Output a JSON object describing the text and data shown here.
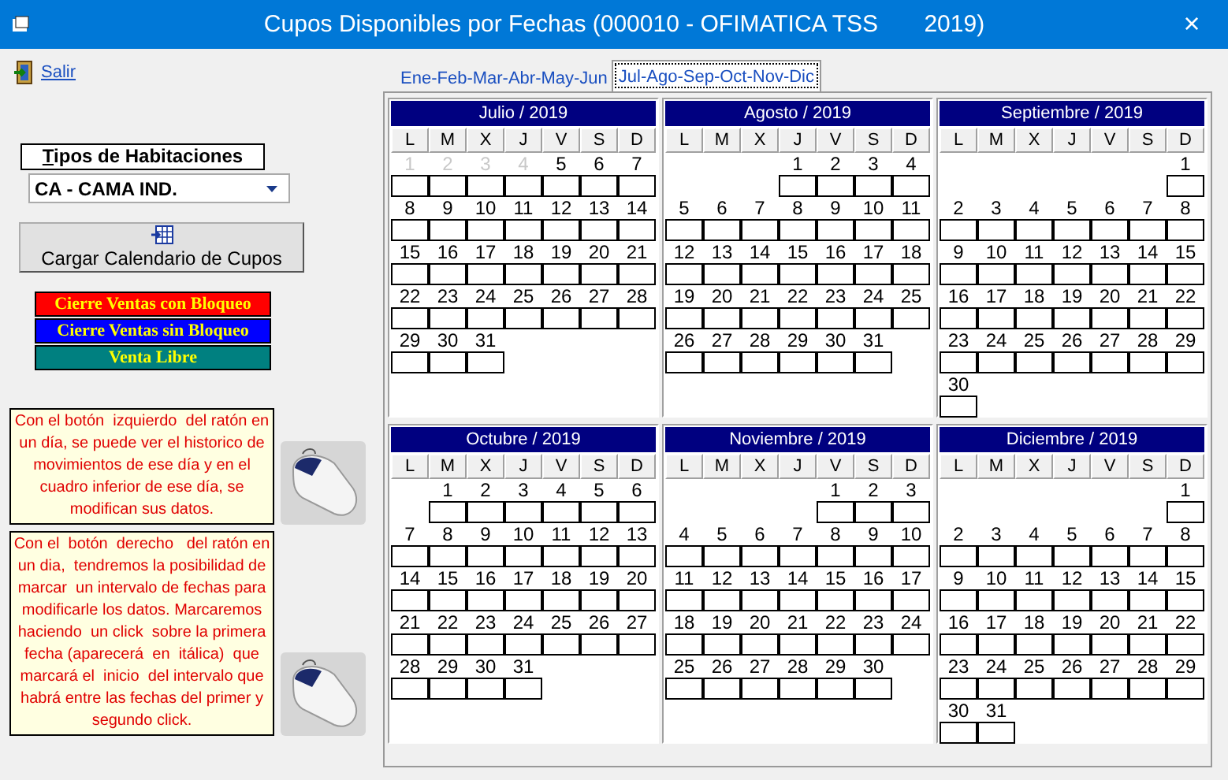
{
  "window": {
    "title": "Cupos Disponibles por Fechas (000010 - OFIMATICA TSS       2019)",
    "close": "×"
  },
  "exit_link": "Salir",
  "room_types": {
    "label": "Tipos de Habitaciones",
    "value": "CA - CAMA IND."
  },
  "load_button": "Cargar Calendario de Cupos",
  "legend": [
    {
      "label": "Cierre Ventas con Bloqueo",
      "color": "#ff0000"
    },
    {
      "label": "Cierre Ventas sin Bloqueo",
      "color": "#0000ff"
    },
    {
      "label": "Venta Libre",
      "color": "#008080"
    }
  ],
  "notes": [
    "Con el botón  izquierdo  del ratón en un día, se puede ver el historico de movimientos de ese día y en el cuadro inferior de ese día, se modifican sus datos.",
    "Con el  botón  derecho   del ratón en un dia,  tendremos la posibilidad de marcar  un intervalo de fechas para modificarle los datos. Marcaremos haciendo  un click  sobre la primera fecha (aparecerá  en  itálica)  que marcará el  inicio  del intervalo que habrá entre las fechas del primer y segundo click."
  ],
  "tabs": [
    {
      "label": "Ene-Feb-Mar-Abr-May-Jun",
      "selected": false
    },
    {
      "label": "Jul-Ago-Sep-Oct-Nov-Dic",
      "selected": true
    }
  ],
  "months": [
    {
      "title": "Julio / 2019",
      "weekdays": [
        "L",
        "M",
        "X",
        "J",
        "V",
        "S",
        "D"
      ],
      "weeks": [
        {
          "kind": "first",
          "days": [
            {
              "n": "1",
              "disabled": true
            },
            {
              "n": "2",
              "disabled": true
            },
            {
              "n": "3",
              "disabled": true
            },
            {
              "n": "4",
              "disabled": true
            },
            {
              "n": "5",
              "disabled": false
            },
            {
              "n": "6",
              "disabled": false
            },
            {
              "n": "7",
              "disabled": false
            }
          ]
        },
        {
          "kind": "full",
          "days": [
            {
              "n": "8",
              "disabled": false
            },
            {
              "n": "9",
              "disabled": false
            },
            {
              "n": "10",
              "disabled": false
            },
            {
              "n": "11",
              "disabled": false
            },
            {
              "n": "12",
              "disabled": false
            },
            {
              "n": "13",
              "disabled": false
            },
            {
              "n": "14",
              "disabled": false
            }
          ]
        },
        {
          "kind": "full",
          "days": [
            {
              "n": "15",
              "disabled": false
            },
            {
              "n": "16",
              "disabled": false
            },
            {
              "n": "17",
              "disabled": false
            },
            {
              "n": "18",
              "disabled": false
            },
            {
              "n": "19",
              "disabled": false
            },
            {
              "n": "20",
              "disabled": false
            },
            {
              "n": "21",
              "disabled": false
            }
          ]
        },
        {
          "kind": "full",
          "days": [
            {
              "n": "22",
              "disabled": false
            },
            {
              "n": "23",
              "disabled": false
            },
            {
              "n": "24",
              "disabled": false
            },
            {
              "n": "25",
              "disabled": false
            },
            {
              "n": "26",
              "disabled": false
            },
            {
              "n": "27",
              "disabled": false
            },
            {
              "n": "28",
              "disabled": false
            }
          ]
        },
        {
          "kind": "full",
          "days": [
            {
              "n": "29",
              "disabled": false
            },
            {
              "n": "30",
              "disabled": false
            },
            {
              "n": "31",
              "disabled": false
            }
          ]
        }
      ]
    },
    {
      "title": "Agosto / 2019",
      "weekdays": [
        "L",
        "M",
        "X",
        "J",
        "V",
        "S",
        "D"
      ],
      "weeks": [
        {
          "kind": "first",
          "days": [
            {
              "n": "1",
              "disabled": false
            },
            {
              "n": "2",
              "disabled": false
            },
            {
              "n": "3",
              "disabled": false
            },
            {
              "n": "4",
              "disabled": false
            }
          ]
        },
        {
          "kind": "full",
          "days": [
            {
              "n": "5",
              "disabled": false
            },
            {
              "n": "6",
              "disabled": false
            },
            {
              "n": "7",
              "disabled": false
            },
            {
              "n": "8",
              "disabled": false
            },
            {
              "n": "9",
              "disabled": false
            },
            {
              "n": "10",
              "disabled": false
            },
            {
              "n": "11",
              "disabled": false
            }
          ]
        },
        {
          "kind": "full",
          "days": [
            {
              "n": "12",
              "disabled": false
            },
            {
              "n": "13",
              "disabled": false
            },
            {
              "n": "14",
              "disabled": false
            },
            {
              "n": "15",
              "disabled": false
            },
            {
              "n": "16",
              "disabled": false
            },
            {
              "n": "17",
              "disabled": false
            },
            {
              "n": "18",
              "disabled": false
            }
          ]
        },
        {
          "kind": "full",
          "days": [
            {
              "n": "19",
              "disabled": false
            },
            {
              "n": "20",
              "disabled": false
            },
            {
              "n": "21",
              "disabled": false
            },
            {
              "n": "22",
              "disabled": false
            },
            {
              "n": "23",
              "disabled": false
            },
            {
              "n": "24",
              "disabled": false
            },
            {
              "n": "25",
              "disabled": false
            }
          ]
        },
        {
          "kind": "full",
          "days": [
            {
              "n": "26",
              "disabled": false
            },
            {
              "n": "27",
              "disabled": false
            },
            {
              "n": "28",
              "disabled": false
            },
            {
              "n": "29",
              "disabled": false
            },
            {
              "n": "30",
              "disabled": false
            },
            {
              "n": "31",
              "disabled": false
            }
          ]
        }
      ]
    },
    {
      "title": "Septiembre / 2019",
      "weekdays": [
        "L",
        "M",
        "X",
        "J",
        "V",
        "S",
        "D"
      ],
      "weeks": [
        {
          "kind": "first",
          "days": [
            {
              "n": "1",
              "disabled": false
            }
          ]
        },
        {
          "kind": "full",
          "days": [
            {
              "n": "2",
              "disabled": false
            },
            {
              "n": "3",
              "disabled": false
            },
            {
              "n": "4",
              "disabled": false
            },
            {
              "n": "5",
              "disabled": false
            },
            {
              "n": "6",
              "disabled": false
            },
            {
              "n": "7",
              "disabled": false
            },
            {
              "n": "8",
              "disabled": false
            }
          ]
        },
        {
          "kind": "full",
          "days": [
            {
              "n": "9",
              "disabled": false
            },
            {
              "n": "10",
              "disabled": false
            },
            {
              "n": "11",
              "disabled": false
            },
            {
              "n": "12",
              "disabled": false
            },
            {
              "n": "13",
              "disabled": false
            },
            {
              "n": "14",
              "disabled": false
            },
            {
              "n": "15",
              "disabled": false
            }
          ]
        },
        {
          "kind": "full",
          "days": [
            {
              "n": "16",
              "disabled": false
            },
            {
              "n": "17",
              "disabled": false
            },
            {
              "n": "18",
              "disabled": false
            },
            {
              "n": "19",
              "disabled": false
            },
            {
              "n": "20",
              "disabled": false
            },
            {
              "n": "21",
              "disabled": false
            },
            {
              "n": "22",
              "disabled": false
            }
          ]
        },
        {
          "kind": "full",
          "days": [
            {
              "n": "23",
              "disabled": false
            },
            {
              "n": "24",
              "disabled": false
            },
            {
              "n": "25",
              "disabled": false
            },
            {
              "n": "26",
              "disabled": false
            },
            {
              "n": "27",
              "disabled": false
            },
            {
              "n": "28",
              "disabled": false
            },
            {
              "n": "29",
              "disabled": false
            }
          ]
        },
        {
          "kind": "full",
          "days": [
            {
              "n": "30",
              "disabled": false
            }
          ]
        }
      ]
    },
    {
      "title": "Octubre / 2019",
      "weekdays": [
        "L",
        "M",
        "X",
        "J",
        "V",
        "S",
        "D"
      ],
      "weeks": [
        {
          "kind": "first",
          "days": [
            {
              "n": "1",
              "disabled": false
            },
            {
              "n": "2",
              "disabled": false
            },
            {
              "n": "3",
              "disabled": false
            },
            {
              "n": "4",
              "disabled": false
            },
            {
              "n": "5",
              "disabled": false
            },
            {
              "n": "6",
              "disabled": false
            }
          ]
        },
        {
          "kind": "full",
          "days": [
            {
              "n": "7",
              "disabled": false
            },
            {
              "n": "8",
              "disabled": false
            },
            {
              "n": "9",
              "disabled": false
            },
            {
              "n": "10",
              "disabled": false
            },
            {
              "n": "11",
              "disabled": false
            },
            {
              "n": "12",
              "disabled": false
            },
            {
              "n": "13",
              "disabled": false
            }
          ]
        },
        {
          "kind": "full",
          "days": [
            {
              "n": "14",
              "disabled": false
            },
            {
              "n": "15",
              "disabled": false
            },
            {
              "n": "16",
              "disabled": false
            },
            {
              "n": "17",
              "disabled": false
            },
            {
              "n": "18",
              "disabled": false
            },
            {
              "n": "19",
              "disabled": false
            },
            {
              "n": "20",
              "disabled": false
            }
          ]
        },
        {
          "kind": "full",
          "days": [
            {
              "n": "21",
              "disabled": false
            },
            {
              "n": "22",
              "disabled": false
            },
            {
              "n": "23",
              "disabled": false
            },
            {
              "n": "24",
              "disabled": false
            },
            {
              "n": "25",
              "disabled": false
            },
            {
              "n": "26",
              "disabled": false
            },
            {
              "n": "27",
              "disabled": false
            }
          ]
        },
        {
          "kind": "full",
          "days": [
            {
              "n": "28",
              "disabled": false
            },
            {
              "n": "29",
              "disabled": false
            },
            {
              "n": "30",
              "disabled": false
            },
            {
              "n": "31",
              "disabled": false
            }
          ]
        }
      ]
    },
    {
      "title": "Noviembre / 2019",
      "weekdays": [
        "L",
        "M",
        "X",
        "J",
        "V",
        "S",
        "D"
      ],
      "weeks": [
        {
          "kind": "first",
          "days": [
            {
              "n": "1",
              "disabled": false
            },
            {
              "n": "2",
              "disabled": false
            },
            {
              "n": "3",
              "disabled": false
            }
          ]
        },
        {
          "kind": "full",
          "days": [
            {
              "n": "4",
              "disabled": false
            },
            {
              "n": "5",
              "disabled": false
            },
            {
              "n": "6",
              "disabled": false
            },
            {
              "n": "7",
              "disabled": false
            },
            {
              "n": "8",
              "disabled": false
            },
            {
              "n": "9",
              "disabled": false
            },
            {
              "n": "10",
              "disabled": false
            }
          ]
        },
        {
          "kind": "full",
          "days": [
            {
              "n": "11",
              "disabled": false
            },
            {
              "n": "12",
              "disabled": false
            },
            {
              "n": "13",
              "disabled": false
            },
            {
              "n": "14",
              "disabled": false
            },
            {
              "n": "15",
              "disabled": false
            },
            {
              "n": "16",
              "disabled": false
            },
            {
              "n": "17",
              "disabled": false
            }
          ]
        },
        {
          "kind": "full",
          "days": [
            {
              "n": "18",
              "disabled": false
            },
            {
              "n": "19",
              "disabled": false
            },
            {
              "n": "20",
              "disabled": false
            },
            {
              "n": "21",
              "disabled": false
            },
            {
              "n": "22",
              "disabled": false
            },
            {
              "n": "23",
              "disabled": false
            },
            {
              "n": "24",
              "disabled": false
            }
          ]
        },
        {
          "kind": "full",
          "days": [
            {
              "n": "25",
              "disabled": false
            },
            {
              "n": "26",
              "disabled": false
            },
            {
              "n": "27",
              "disabled": false
            },
            {
              "n": "28",
              "disabled": false
            },
            {
              "n": "29",
              "disabled": false
            },
            {
              "n": "30",
              "disabled": false
            }
          ]
        }
      ]
    },
    {
      "title": "Diciembre / 2019",
      "weekdays": [
        "L",
        "M",
        "X",
        "J",
        "V",
        "S",
        "D"
      ],
      "weeks": [
        {
          "kind": "first",
          "days": [
            {
              "n": "1",
              "disabled": false
            }
          ]
        },
        {
          "kind": "full",
          "days": [
            {
              "n": "2",
              "disabled": false
            },
            {
              "n": "3",
              "disabled": false
            },
            {
              "n": "4",
              "disabled": false
            },
            {
              "n": "5",
              "disabled": false
            },
            {
              "n": "6",
              "disabled": false
            },
            {
              "n": "7",
              "disabled": false
            },
            {
              "n": "8",
              "disabled": false
            }
          ]
        },
        {
          "kind": "full",
          "days": [
            {
              "n": "9",
              "disabled": false
            },
            {
              "n": "10",
              "disabled": false
            },
            {
              "n": "11",
              "disabled": false
            },
            {
              "n": "12",
              "disabled": false
            },
            {
              "n": "13",
              "disabled": false
            },
            {
              "n": "14",
              "disabled": false
            },
            {
              "n": "15",
              "disabled": false
            }
          ]
        },
        {
          "kind": "full",
          "days": [
            {
              "n": "16",
              "disabled": false
            },
            {
              "n": "17",
              "disabled": false
            },
            {
              "n": "18",
              "disabled": false
            },
            {
              "n": "19",
              "disabled": false
            },
            {
              "n": "20",
              "disabled": false
            },
            {
              "n": "21",
              "disabled": false
            },
            {
              "n": "22",
              "disabled": false
            }
          ]
        },
        {
          "kind": "full",
          "days": [
            {
              "n": "23",
              "disabled": false
            },
            {
              "n": "24",
              "disabled": false
            },
            {
              "n": "25",
              "disabled": false
            },
            {
              "n": "26",
              "disabled": false
            },
            {
              "n": "27",
              "disabled": false
            },
            {
              "n": "28",
              "disabled": false
            },
            {
              "n": "29",
              "disabled": false
            }
          ]
        },
        {
          "kind": "full",
          "days": [
            {
              "n": "30",
              "disabled": false
            },
            {
              "n": "31",
              "disabled": false
            }
          ]
        }
      ]
    }
  ]
}
